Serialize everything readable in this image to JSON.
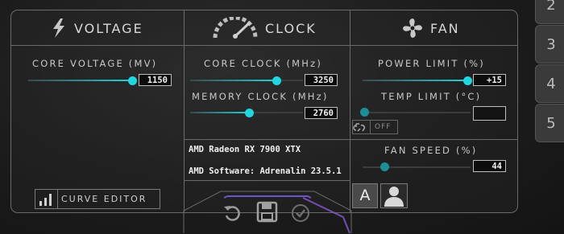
{
  "headers": {
    "voltage": "VOLTAGE",
    "clock": "CLOCK",
    "fan": "FAN"
  },
  "voltage": {
    "core_voltage_label": "CORE VOLTAGE (MV)",
    "core_voltage_value": "1150",
    "core_voltage_fraction": 0.92
  },
  "clock": {
    "core_clock_label": "CORE CLOCK (MHz)",
    "core_clock_value": "3250",
    "core_clock_fraction": 0.85,
    "memory_clock_label": "MEMORY CLOCK (MHz)",
    "memory_clock_value": "2760",
    "memory_clock_fraction": 0.53
  },
  "fan": {
    "power_limit_label": "POWER LIMIT (%)",
    "power_limit_value": "+15",
    "power_limit_fraction": 0.99,
    "temp_limit_label": "TEMP LIMIT (°C)",
    "temp_limit_value": "",
    "link_toggle_label": "OFF",
    "fan_speed_label": "FAN SPEED (%)",
    "fan_speed_value": "44"
  },
  "gpu_info": {
    "gpu_name": "AMD Radeon RX 7900 XTX",
    "software": "AMD Software: Adrenalin 23.5.1"
  },
  "buttons": {
    "curve_editor": "CURVE EDITOR",
    "auto_mode": "A"
  },
  "profile_tabs": [
    "2",
    "3",
    "4",
    "5"
  ],
  "colors": {
    "accent": "#22d6e0",
    "panel_border": "#6a6a6a",
    "background": "#1c1c1c"
  }
}
